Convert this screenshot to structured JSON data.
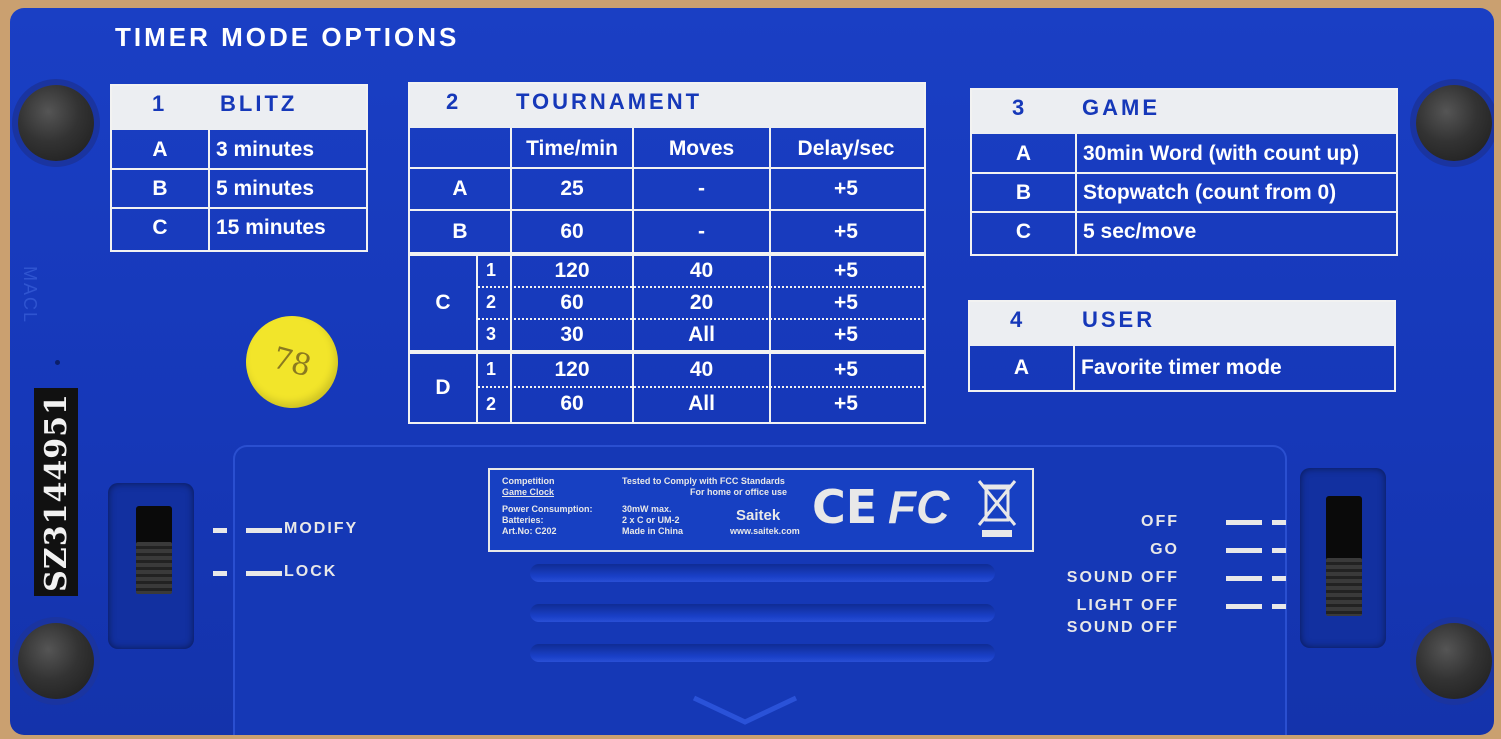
{
  "title": "TIMER MODE OPTIONS",
  "blitz": {
    "num": "1",
    "name": "BLITZ",
    "rows": [
      {
        "key": "A",
        "value": "3 minutes"
      },
      {
        "key": "B",
        "value": "5 minutes"
      },
      {
        "key": "C",
        "value": "15 minutes"
      }
    ]
  },
  "tournament": {
    "num": "2",
    "name": "TOURNAMENT",
    "cols": [
      "Time/min",
      "Moves",
      "Delay/sec"
    ],
    "rows": [
      {
        "key": "A",
        "time": "25",
        "moves": "-",
        "delay": "+5"
      },
      {
        "key": "B",
        "time": "60",
        "moves": "-",
        "delay": "+5"
      }
    ],
    "c": {
      "key": "C",
      "subs": [
        {
          "n": "1",
          "time": "120",
          "moves": "40",
          "delay": "+5"
        },
        {
          "n": "2",
          "time": "60",
          "moves": "20",
          "delay": "+5"
        },
        {
          "n": "3",
          "time": "30",
          "moves": "All",
          "delay": "+5"
        }
      ]
    },
    "d": {
      "key": "D",
      "subs": [
        {
          "n": "1",
          "time": "120",
          "moves": "40",
          "delay": "+5"
        },
        {
          "n": "2",
          "time": "60",
          "moves": "All",
          "delay": "+5"
        }
      ]
    }
  },
  "game": {
    "num": "3",
    "name": "GAME",
    "rows": [
      {
        "key": "A",
        "value": "30min Word (with count up)"
      },
      {
        "key": "B",
        "value": "Stopwatch (count from 0)"
      },
      {
        "key": "C",
        "value": "5 sec/move"
      }
    ]
  },
  "user": {
    "num": "4",
    "name": "USER",
    "rows": [
      {
        "key": "A",
        "value": "Favorite timer mode"
      }
    ]
  },
  "sticker_text": "78",
  "serial": "SZ3144951",
  "side_label": "MACL",
  "left_switch": {
    "labels": [
      "MODIFY",
      "LOCK"
    ]
  },
  "right_switch": {
    "labels": [
      "OFF",
      "GO",
      "SOUND OFF",
      "LIGHT OFF",
      "SOUND OFF"
    ]
  },
  "label": {
    "product1": "Competition",
    "product2": "Game Clock",
    "power": "Power Consumption:",
    "power_val": "30mW max.",
    "batteries": "Batteries:",
    "batteries_val": "2 x C or UM-2",
    "artno": "Art.No: C202",
    "made": "Made in China",
    "fcc1": "Tested to Comply with FCC Standards",
    "fcc2": "For home or office use",
    "brand": "Saitek",
    "web": "www.saitek.com",
    "ce": "CE",
    "fc": "FC"
  },
  "colors": {
    "body": "#1638b9",
    "panel": "#eceef2",
    "text": "#ffffff",
    "sticker": "#f2e52a"
  }
}
